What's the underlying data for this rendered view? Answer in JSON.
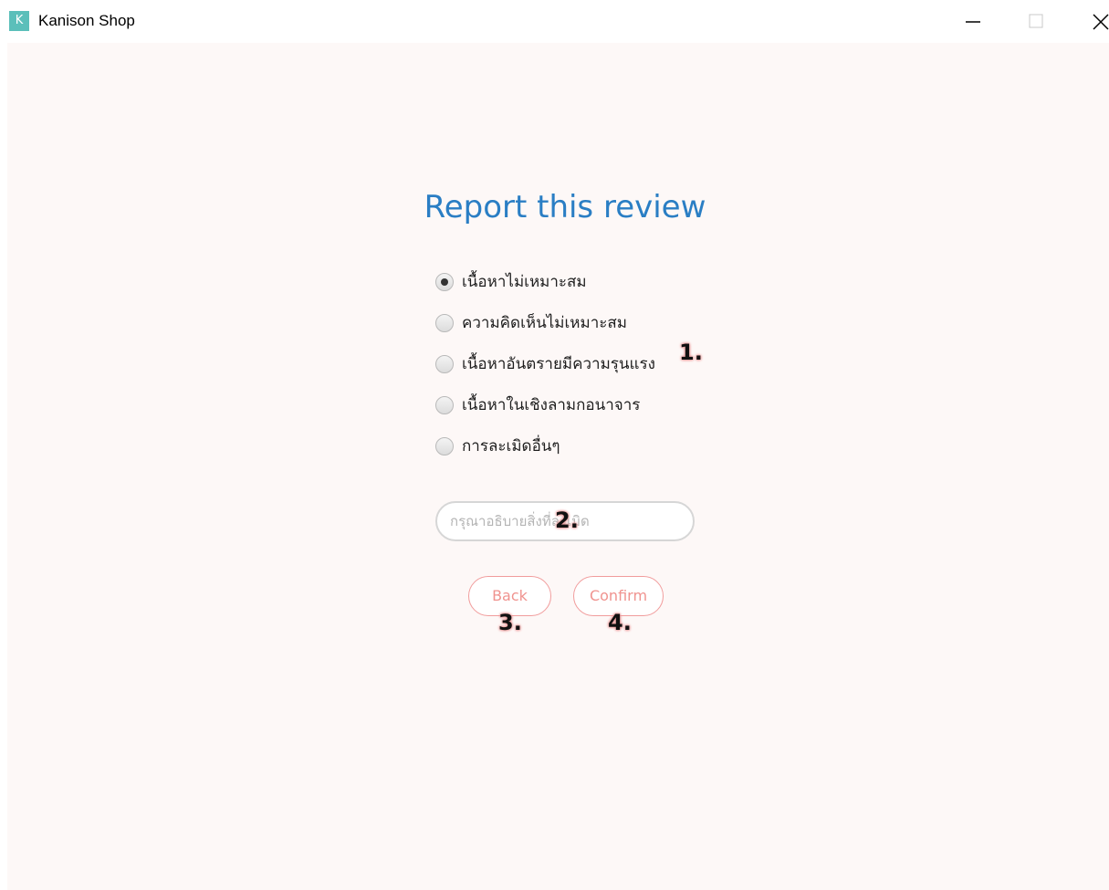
{
  "window": {
    "app_icon_letter": "K",
    "title": "Kanison Shop"
  },
  "page": {
    "heading": "Report this review",
    "options": [
      {
        "label": "เนื้อหาไม่เหมาะสม",
        "selected": true
      },
      {
        "label": "ความคิดเห็นไม่เหมาะสม",
        "selected": false
      },
      {
        "label": "เนื้อหาอันตรายมีความรุนแรง",
        "selected": false
      },
      {
        "label": "เนื้อหาในเชิงลามกอนาจาร",
        "selected": false
      },
      {
        "label": "การละเมิดอื่นๆ",
        "selected": false
      }
    ],
    "detail_input": {
      "placeholder": "กรุณาอธิบายสิ่งที่ละเมิด",
      "value": ""
    },
    "back_button": "Back",
    "confirm_button": "Confirm"
  },
  "annotations": {
    "a1": "1.",
    "a2": "2.",
    "a3": "3.",
    "a4": "4."
  },
  "colors": {
    "heading": "#2a7ec4",
    "button_border": "#f19c9c",
    "button_text": "#f0938f",
    "background": "#fdf8f7",
    "app_icon": "#5bbfba"
  },
  "icons": {
    "minimize": "minimize-icon",
    "maximize": "maximize-icon",
    "close": "close-icon"
  }
}
